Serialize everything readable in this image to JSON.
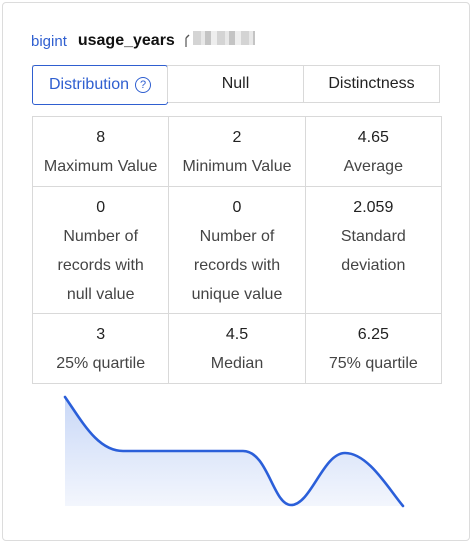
{
  "header": {
    "type": "bigint",
    "column": "usage_years"
  },
  "tabs": [
    {
      "label": "Distribution",
      "active": true,
      "help_icon": "?"
    },
    {
      "label": "Null"
    },
    {
      "label": "Distinctness"
    }
  ],
  "stats": [
    [
      {
        "value": "8",
        "label": "Maximum Value"
      },
      {
        "value": "2",
        "label": "Minimum Value"
      },
      {
        "value": "4.65",
        "label": "Average"
      }
    ],
    [
      {
        "value": "0",
        "label": "Number of records with null value"
      },
      {
        "value": "0",
        "label": "Number of records with unique value"
      },
      {
        "value": "2.059",
        "label": "Standard deviation"
      }
    ],
    [
      {
        "value": "3",
        "label": "25% quartile"
      },
      {
        "value": "4.5",
        "label": "Median"
      },
      {
        "value": "6.25",
        "label": "75% quartile"
      }
    ]
  ],
  "colors": {
    "accent": "#2f5fd0",
    "curve": "#2b5fd9",
    "fill_top": "#c9d8f7",
    "fill_bottom": "#f3f6fd"
  }
}
